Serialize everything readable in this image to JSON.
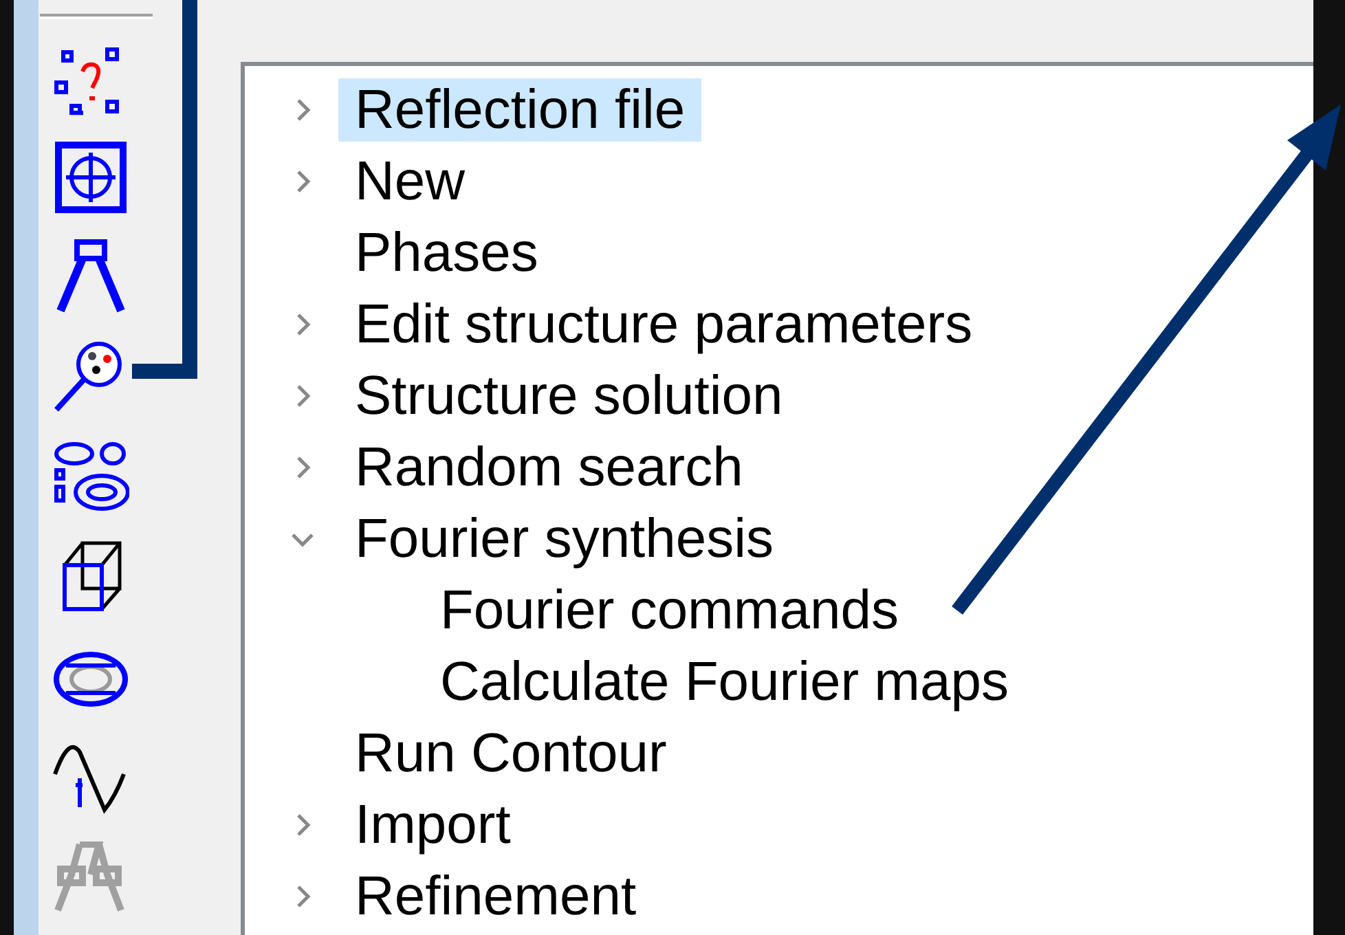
{
  "toolbar": {
    "buttons": [
      {
        "disabled": false
      },
      {
        "disabled": false
      },
      {
        "disabled": false
      },
      {
        "disabled": false
      },
      {
        "disabled": false
      },
      {
        "disabled": false
      },
      {
        "disabled": false
      },
      {
        "disabled": false
      },
      {
        "disabled": true
      }
    ]
  },
  "tree": {
    "items": [
      {
        "label": "Reflection file",
        "expandable": true,
        "expanded": false,
        "selected": true
      },
      {
        "label": "New",
        "expandable": true,
        "expanded": false,
        "selected": false
      },
      {
        "label": "Phases",
        "expandable": false,
        "selected": false
      },
      {
        "label": "Edit structure parameters",
        "expandable": true,
        "expanded": false,
        "selected": false
      },
      {
        "label": "Structure solution",
        "expandable": true,
        "expanded": false,
        "selected": false
      },
      {
        "label": "Random search",
        "expandable": true,
        "expanded": false,
        "selected": false
      },
      {
        "label": "Fourier synthesis",
        "expandable": true,
        "expanded": true,
        "selected": false,
        "children": [
          {
            "label": "Fourier commands",
            "expandable": false,
            "selected": false
          },
          {
            "label": "Calculate Fourier maps",
            "expandable": false,
            "selected": false
          }
        ]
      },
      {
        "label": "Run Contour",
        "expandable": false,
        "selected": false
      },
      {
        "label": "Import",
        "expandable": true,
        "expanded": false,
        "selected": false
      },
      {
        "label": "Refinement",
        "expandable": true,
        "expanded": false,
        "selected": false
      }
    ]
  }
}
